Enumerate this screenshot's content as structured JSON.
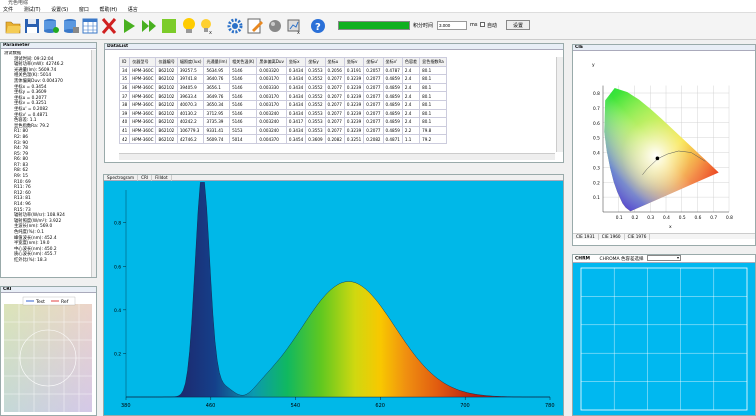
{
  "app": {
    "title": "光色电综"
  },
  "menu": [
    "文件",
    "测试(T)",
    "设置(S)",
    "窗口",
    "帮助(H)",
    "语言"
  ],
  "toolbar": {
    "integration_label": "积分时间",
    "integration_value": "3.000",
    "unit": "ms",
    "auto_label": "自动",
    "set_button": "设置",
    "progress": 1.0
  },
  "parameter": {
    "title": "Parameter",
    "items": [
      "测试数据",
      "测试时间: 09:32:04",
      "辐射功率(mW): 42746.2",
      "光通量(lm): 5609.74",
      "相关色温(K): 5014",
      "黑体偏离Duv: 0.004370",
      "坐标x = 0.3454",
      "坐标y = 0.3609",
      "坐标u = 0.2077",
      "坐标v = 0.3251",
      "坐标u' = 0.2082",
      "坐标v' = 0.4871",
      "色容差: 1.1",
      "显色指数Ra: 79.2",
      "R1: 80",
      "R2: 86",
      "R3: 90",
      "R4: 78",
      "R5: 79",
      "R6: 80",
      "R7: 83",
      "R8: 62",
      "R9: 15",
      "R10: 69",
      "R11: 76",
      "R12: 60",
      "R13: 81",
      "R14: 96",
      "R15: 73",
      "辐射功率(W/sr): 108.924",
      "辐射照度(W/m²): 3.922",
      "主波长(nm): 569.0",
      "色纯度(%): 0.1",
      "峰值波长(nm): 452.4",
      "半宽度(nm): 19.0",
      "中心波长(nm): 450.2",
      "质心波长(nm): 455.7",
      "红外比(%): 18.3"
    ]
  },
  "cie_mini": {
    "title": "CRI",
    "legend_test": "Test",
    "legend_ref": "Ref"
  },
  "datalist": {
    "title": "DataList",
    "headers": [
      "ID",
      "仪器型号",
      "仪器编号",
      "辐照度(lux)",
      "光通量(lm)",
      "相关色温(K)",
      "黑体偏离Duv",
      "坐标x",
      "坐标y",
      "坐标u",
      "坐标v",
      "坐标u'",
      "坐标v'",
      "色容差",
      "显色指数Ra"
    ],
    "rows": [
      [
        "34",
        "HPM-360C",
        "B62102",
        "39257.5",
        "5634.95",
        "5146",
        "0.003320",
        "0.3434",
        "0.3553",
        "0.2056",
        "0.3191",
        "0.2057",
        "0.4787",
        "2.4",
        "80.1"
      ],
      [
        "35",
        "HPM-360C",
        "B62102",
        "39741.8",
        "3640.76",
        "5146",
        "0.003170",
        "0.3434",
        "0.3552",
        "0.2077",
        "0.3239",
        "0.2077",
        "0.4859",
        "2.4",
        "80.1"
      ],
      [
        "36",
        "HPM-360C",
        "B62102",
        "39405.9",
        "3656.1",
        "5146",
        "0.003330",
        "0.3434",
        "0.3552",
        "0.2077",
        "0.3239",
        "0.2077",
        "0.4859",
        "2.4",
        "80.1"
      ],
      [
        "37",
        "HPM-360C",
        "B62102",
        "39633.4",
        "3649.76",
        "5146",
        "0.003170",
        "0.3434",
        "0.3552",
        "0.2077",
        "0.3239",
        "0.2077",
        "0.4859",
        "2.4",
        "80.1"
      ],
      [
        "38",
        "HPM-360C",
        "B62102",
        "40070.3",
        "3650.34",
        "5146",
        "0.003170",
        "0.3434",
        "0.3552",
        "0.2077",
        "0.3239",
        "0.2077",
        "0.4859",
        "2.4",
        "80.1"
      ],
      [
        "39",
        "HPM-360C",
        "B62102",
        "40130.2",
        "3712.95",
        "5146",
        "0.003240",
        "0.3434",
        "0.3553",
        "0.2077",
        "0.3239",
        "0.2077",
        "0.4859",
        "2.4",
        "80.1"
      ],
      [
        "40",
        "HPM-360C",
        "B62102",
        "40242.2",
        "3735.39",
        "5146",
        "0.003240",
        "0.3417",
        "0.3553",
        "0.2077",
        "0.3239",
        "0.2077",
        "0.4859",
        "2.4",
        "80.1"
      ],
      [
        "41",
        "HPM-360C",
        "B62102",
        "106779.3",
        "9331.41",
        "5153",
        "0.003240",
        "0.3434",
        "0.3553",
        "0.2077",
        "0.3239",
        "0.2077",
        "0.4859",
        "2.2",
        "79.8"
      ],
      [
        "42",
        "HPM-360C",
        "B62102",
        "42746.2",
        "5609.74",
        "5014",
        "0.004370",
        "0.3454",
        "0.3609",
        "0.2082",
        "0.3251",
        "0.2082",
        "0.4871",
        "1.1",
        "79.2"
      ]
    ]
  },
  "spectrum": {
    "tabs": [
      "Spectrogram",
      "CRI",
      "Filldot"
    ],
    "xticks": [
      "380",
      "460",
      "540",
      "620",
      "700",
      "780"
    ],
    "yticks": [
      "0.8",
      "0.6",
      "0.4",
      "0.2"
    ]
  },
  "cie": {
    "title": "CIE",
    "tabs": [
      "CIE 1931",
      "CIE 1960",
      "CIE 1976"
    ],
    "xticks": [
      "0.1",
      "0.2",
      "0.3",
      "0.4",
      "0.5",
      "0.6",
      "0.7",
      "0.8"
    ],
    "yticks": [
      "0.8",
      "0.7",
      "0.6",
      "0.5",
      "0.4",
      "0.3",
      "0.2",
      "0.1"
    ],
    "xlabel": "x",
    "ylabel": "y",
    "point": {
      "x": 0.3454,
      "y": 0.3609
    }
  },
  "chrom": {
    "title": "CHRM",
    "label": "CHROMA 色容差选择"
  }
}
